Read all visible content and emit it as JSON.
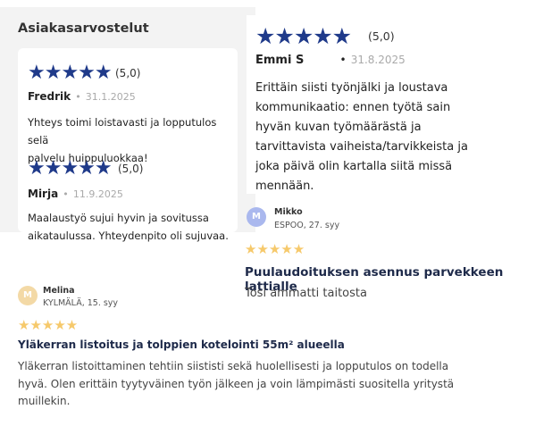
{
  "panel1": {
    "title": "Asiakasarvostelut",
    "reviews": [
      {
        "stars": "★★★★★",
        "rating": "(5,0)",
        "author": "Fredrik",
        "date": "31.1.2025",
        "body": [
          "Yhteys toimi loistavasti ja lopputulos selä",
          "palvelu huippuluokkaa!"
        ]
      },
      {
        "stars": "★★★★★",
        "rating": "(5,0)",
        "author": "Mirja",
        "date": "11.9.2025",
        "body": [
          "Maalaustyö sujui hyvin ja sovitussa",
          "aikataulussa. Yhteydenpito oli sujuvaa."
        ]
      }
    ]
  },
  "panel2": {
    "stars": "★★★★★",
    "rating": "(5,0)",
    "author": "Emmi S",
    "date": "31.8.2025",
    "body": [
      "Erittäin siisti työnjälki ja loustava",
      "kommunikaatio: ennen työtä sain",
      "hyvän kuvan työmäärästä ja",
      "tarvittavista vaiheista/tarvikkeista ja",
      "joka päivä olin kartalla siitä missä",
      "mennään."
    ]
  },
  "panel3": {
    "initial": "M",
    "name": "Mikko",
    "location": "ESPOO, 27. syy",
    "stars": "★★★★★",
    "title": "Puulaudoituksen asennus parvekkeen lattialle",
    "body": "Tosi ammatti taitosta"
  },
  "panel4": {
    "initial": "M",
    "name": "Melina",
    "location": "KYLMÄLÄ, 15. syy",
    "stars": "★★★★★",
    "title": "Yläkerran listoitus ja tolppien kotelointi 55m² alueella",
    "body": [
      "Yläkerran listoittaminen tehtiin siististi sekä huolellisesti ja lopputulos on todella",
      "hyvä. Olen erittäin tyytyväinen työn jälkeen ja voin lämpimästi suositella yritystä",
      "muillekin."
    ]
  },
  "colors": {
    "star_blue": "#1f3a8a",
    "star_gold": "#f6c96b",
    "avatar_mikko": "#aab8ee",
    "avatar_melina": "#f3d9a6"
  }
}
